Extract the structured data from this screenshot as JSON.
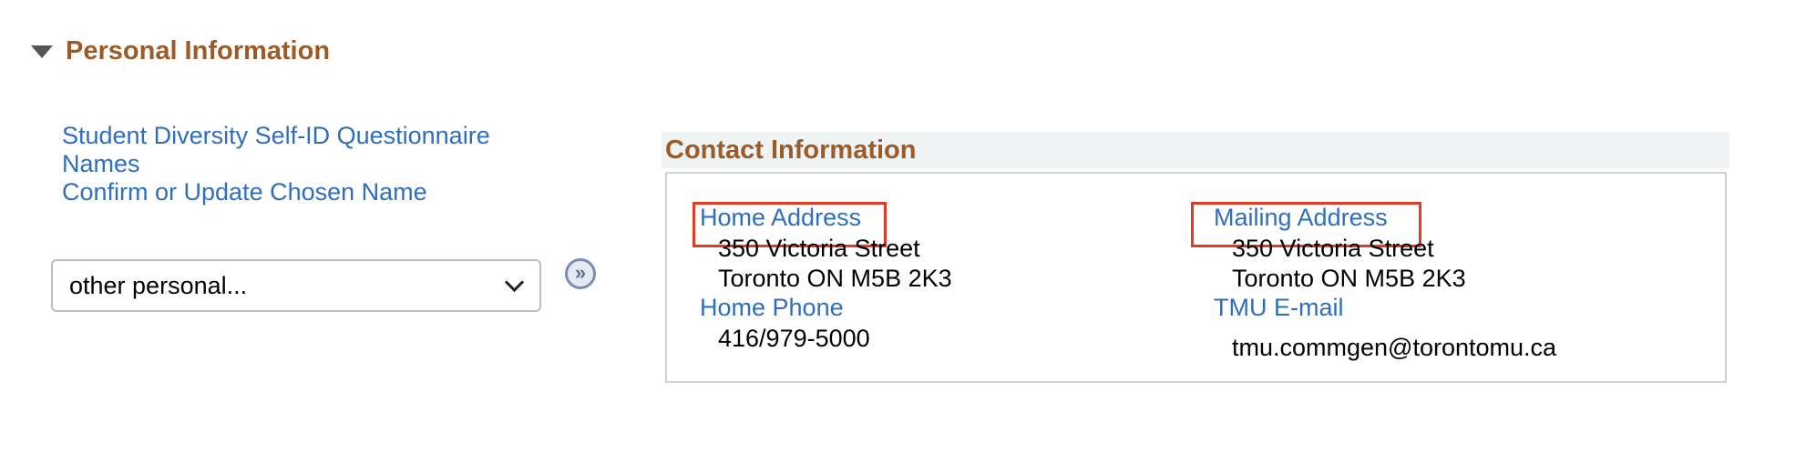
{
  "section": {
    "title": "Personal Information",
    "toggle_icon": "triangle-down-icon"
  },
  "links": [
    "Student Diversity Self-ID Questionnaire",
    "Names",
    "Confirm or Update Chosen Name"
  ],
  "dropdown": {
    "selected": "other personal...",
    "icon": "chevron-down-icon"
  },
  "go_button": {
    "icon": "double-chevron-right-icon",
    "glyph": "»"
  },
  "contact": {
    "title": "Contact Information",
    "home_address": {
      "label": "Home Address",
      "line1": "350 Victoria Street",
      "line2": "Toronto ON M5B 2K3"
    },
    "home_phone": {
      "label": "Home Phone",
      "value": "416/979-5000"
    },
    "mailing_address": {
      "label": "Mailing Address",
      "line1": "350 Victoria Street",
      "line2": "Toronto ON M5B 2K3"
    },
    "email": {
      "label": "TMU E-mail",
      "value": "tmu.commgen@torontomu.ca"
    }
  },
  "colors": {
    "section_title": "#9c5b26",
    "link": "#2f6ebf",
    "highlight": "#e23a24",
    "header_bg": "#f0f3f4"
  }
}
